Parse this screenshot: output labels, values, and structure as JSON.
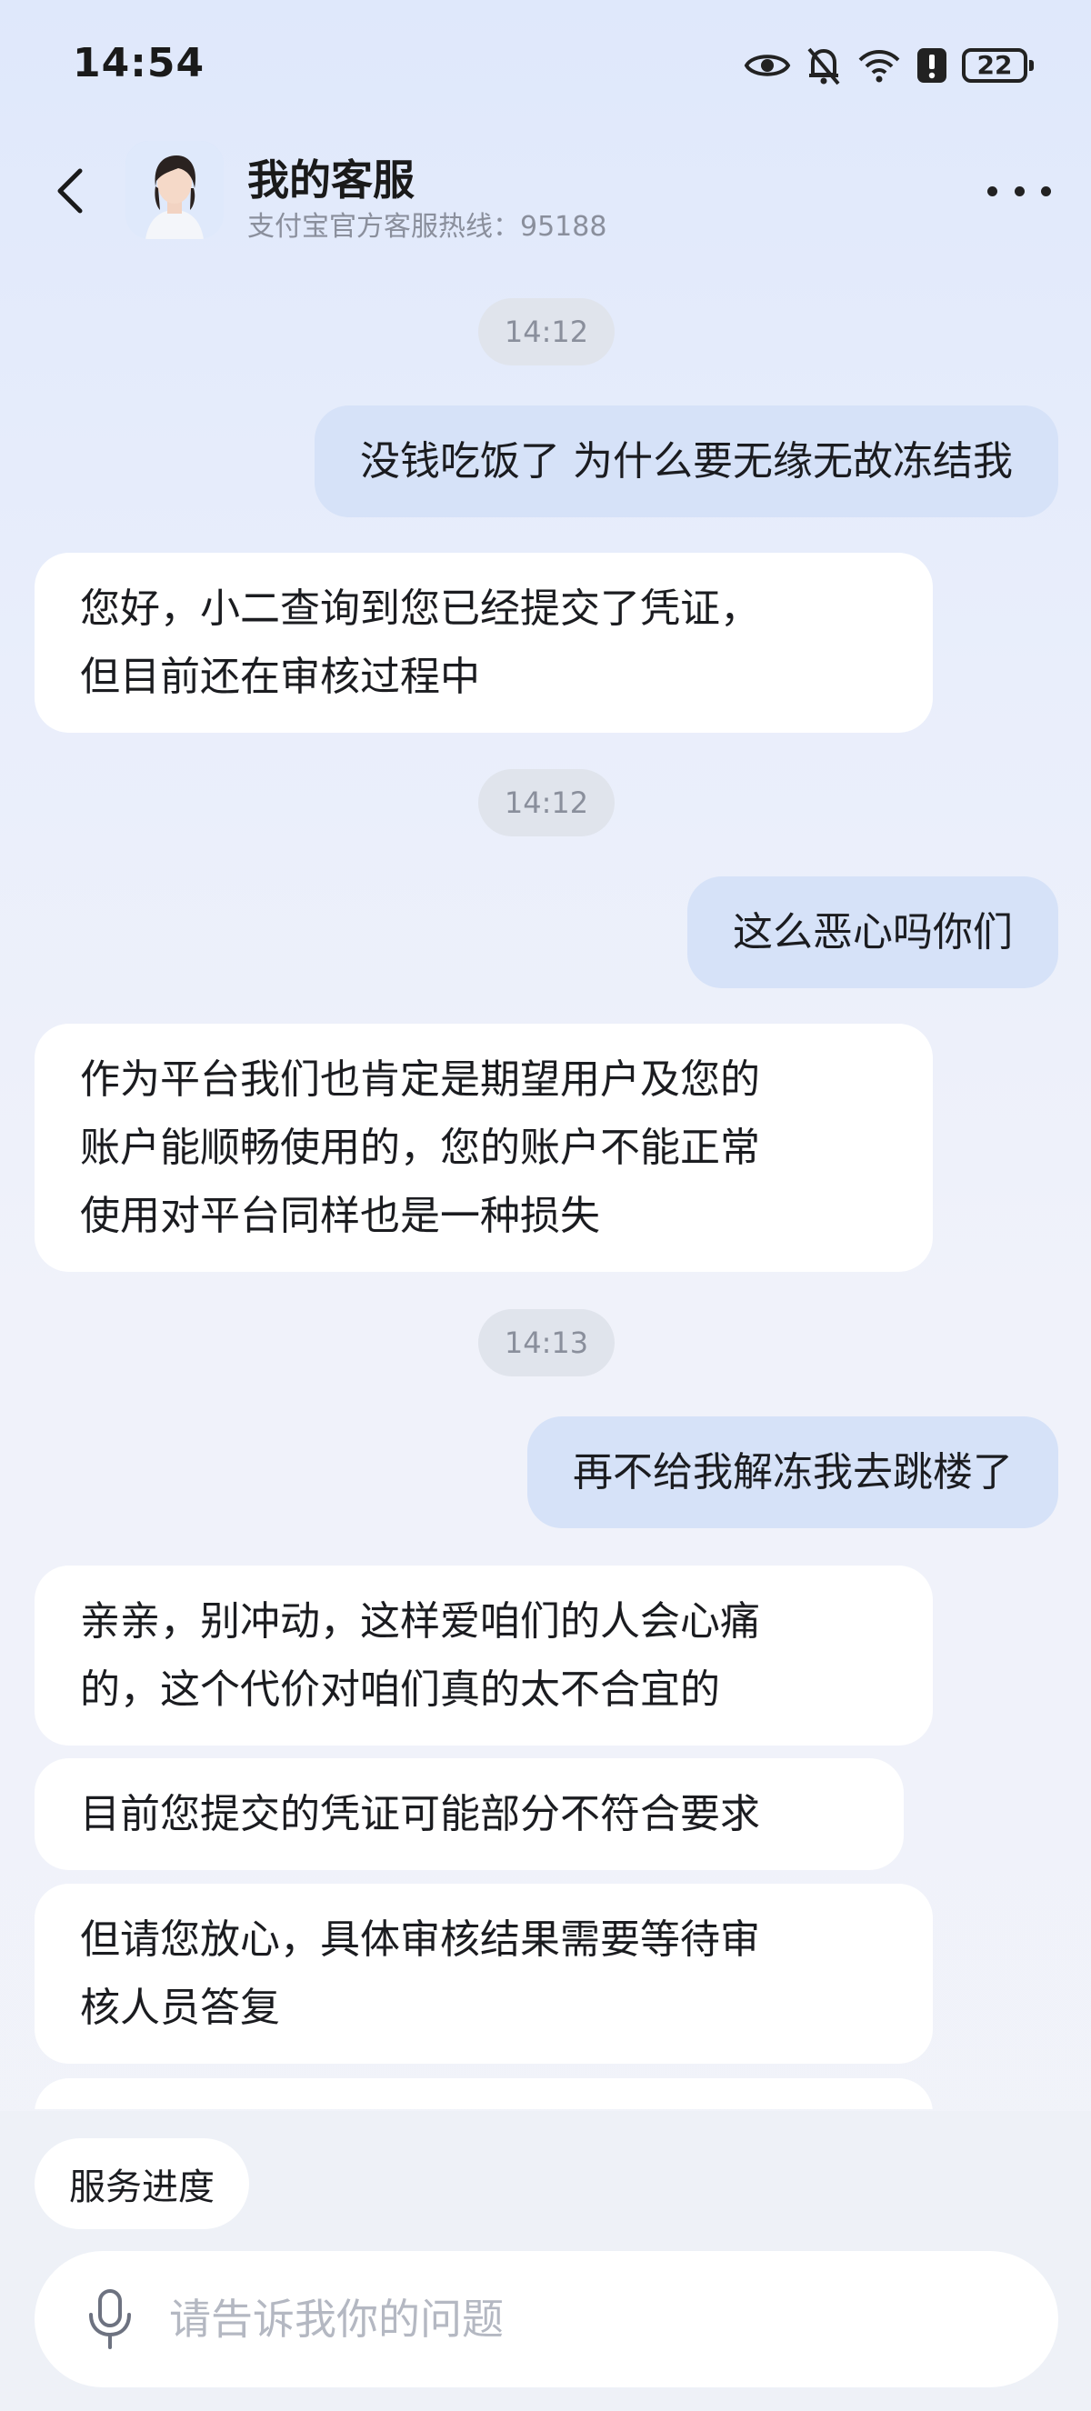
{
  "status_bar": {
    "time": "14:54",
    "battery": "22",
    "icons": [
      "eye-icon",
      "bell-muted-icon",
      "wifi-icon",
      "alert-icon",
      "battery-icon"
    ]
  },
  "header": {
    "title": "我的客服",
    "subtitle": "支付宝官方客服热线：95188",
    "icons": [
      "back-icon",
      "avatar",
      "more-icon"
    ]
  },
  "messages": [
    {
      "type": "time",
      "text": "14:12"
    },
    {
      "type": "user",
      "text": "没钱吃饭了 为什么要无缘无故冻结我"
    },
    {
      "type": "bot",
      "text": "您好，小二查询到您已经提交了凭证，\n但目前还在审核过程中"
    },
    {
      "type": "time",
      "text": "14:12"
    },
    {
      "type": "user",
      "text": "这么恶心吗你们"
    },
    {
      "type": "bot",
      "text": "作为平台我们也肯定是期望用户及您的\n账户能顺畅使用的，您的账户不能正常\n使用对平台同样也是一种损失"
    },
    {
      "type": "time",
      "text": "14:13"
    },
    {
      "type": "user",
      "text": "再不给我解冻我去跳楼了"
    },
    {
      "type": "bot",
      "text": "亲亲，别冲动，这样爱咱们的人会心痛\n的，这个代价对咱们真的太不合宜的"
    },
    {
      "type": "bot",
      "text": "目前您提交的凭证可能部分不符合要求"
    },
    {
      "type": "bot",
      "text": "但请您放心，具体审核结果需要等待审\n核人员答复"
    },
    {
      "type": "bot",
      "text": ""
    }
  ],
  "bottom": {
    "chip": "服务进度",
    "input_placeholder": "请告诉我你的问题",
    "icons": [
      "mic-icon"
    ]
  },
  "colors": {
    "user_bubble": "#d6e2f8",
    "bot_bubble": "#ffffff",
    "time_pill": "#e0e4ec",
    "placeholder": "#b4b8c2"
  }
}
